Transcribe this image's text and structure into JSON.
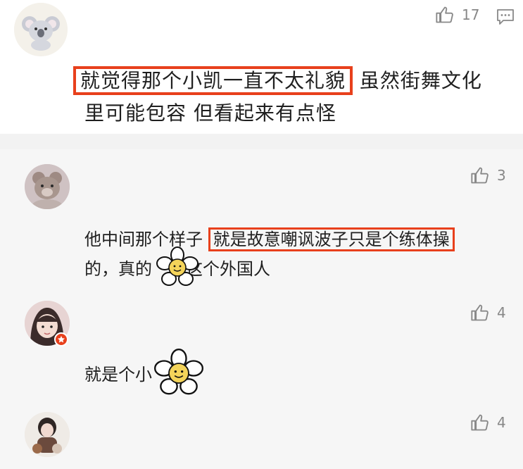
{
  "top_comment": {
    "likes": "17",
    "highlighted_text": "就觉得那个小凯一直不太礼貌",
    "text_rest_line1": "虽然街舞文化",
    "text_line2": "里可能包容 但看起来有点怪"
  },
  "replies": [
    {
      "likes": "3",
      "text_prefix": "他中间那个样子",
      "highlighted_text": "就是故意嘲讽波子只是个练体操",
      "line2_a": "的，真的",
      "line2_b": "这个外国人"
    },
    {
      "likes": "4",
      "text": "就是个小"
    },
    {
      "likes": "4"
    }
  ],
  "colors": {
    "highlight": "#e8401c",
    "like_gray": "#888888",
    "reply_bg": "#f6f6f6"
  },
  "icons": {
    "like": "thumbs-up-icon",
    "reply": "comment-icon",
    "sticker": "flower-smiley-sticker"
  }
}
